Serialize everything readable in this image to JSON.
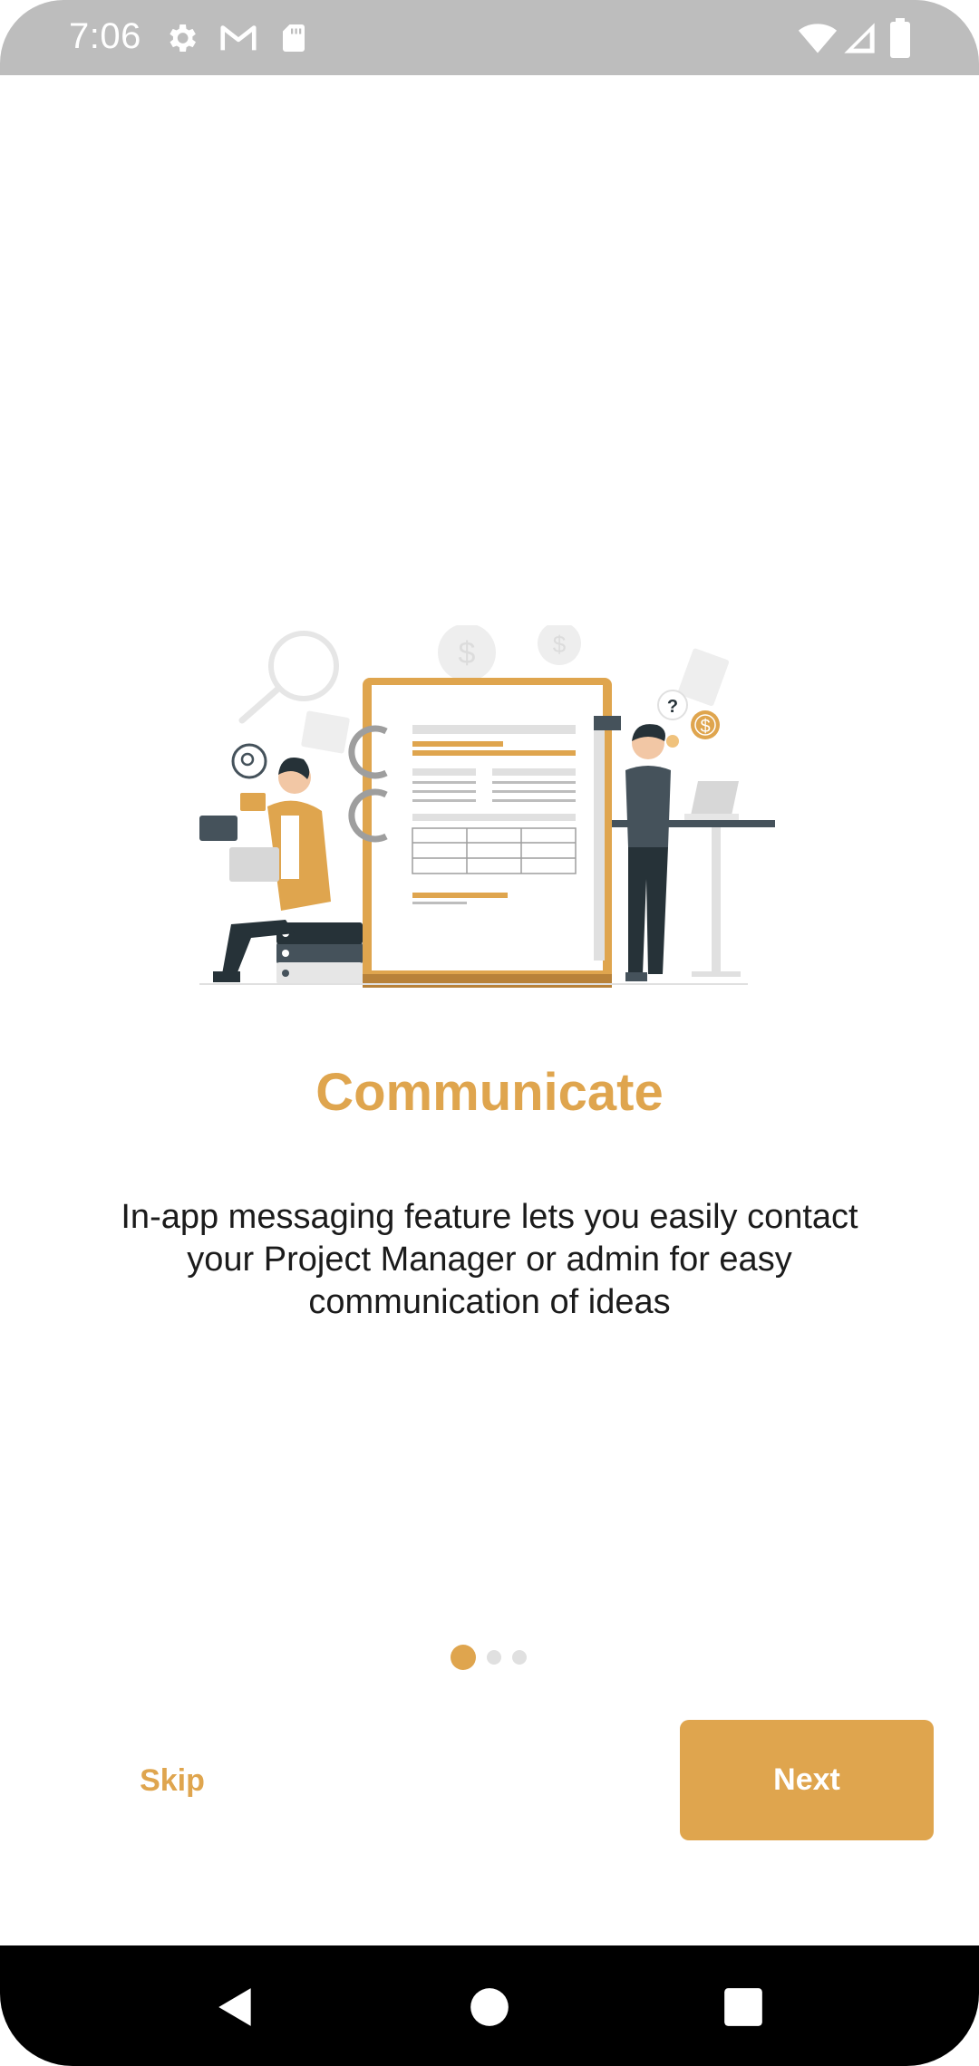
{
  "status_bar": {
    "time": "7:06",
    "icons": [
      "gear-icon",
      "gmail-icon",
      "sd-card-icon",
      "wifi-icon",
      "signal-icon",
      "battery-icon"
    ]
  },
  "onboarding": {
    "title": "Communicate",
    "description": "In-app messaging feature lets you easily contact your Project Manager or admin for easy communication of ideas",
    "page_index": 1,
    "page_count": 3
  },
  "actions": {
    "skip_label": "Skip",
    "next_label": "Next"
  },
  "nav_bar": {
    "buttons": [
      "back-icon",
      "home-icon",
      "recents-icon"
    ]
  },
  "colors": {
    "accent": "#dfa54e",
    "dot_inactive": "#e0e0e0",
    "status_bar": "#bdbdbd",
    "nav_bar": "#000000"
  }
}
